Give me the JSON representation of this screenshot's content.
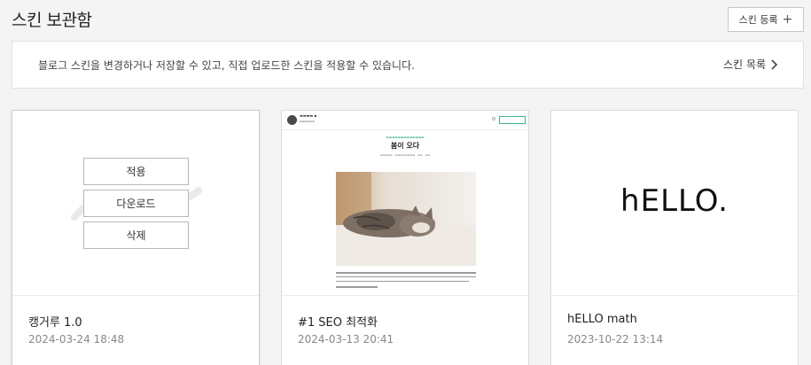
{
  "header": {
    "title": "스킨 보관함",
    "register_label": "스킨 등록",
    "register_icon": "plus-icon"
  },
  "info": {
    "text": "블로그 스킨을 변경하거나 저장할 수 있고, 직접 업로드한 스킨을 적용할 수 있습니다.",
    "list_link": "스킨 목록"
  },
  "cards": [
    {
      "title": "캥거루 1.0",
      "date": "2024-03-24 18:48",
      "actions": [
        "적용",
        "다운로드",
        "삭제"
      ]
    },
    {
      "title": "#1 SEO 최적화",
      "date": "2024-03-13 20:41",
      "thumbnail": {
        "post_title": "봄이 오다"
      }
    },
    {
      "title": "hELLO math",
      "date": "2023-10-22 13:14",
      "thumbnail_text": "hELLO."
    }
  ],
  "colors": {
    "background": "#f4f4f4",
    "accent_green": "#3fb58c"
  }
}
